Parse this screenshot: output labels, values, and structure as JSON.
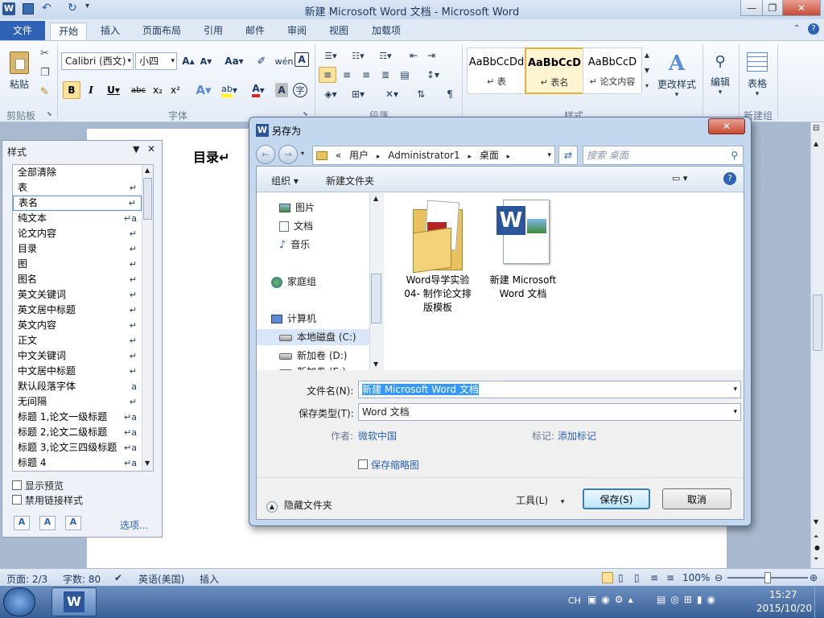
{
  "window": {
    "title": "新建 Microsoft Word 文档 - Microsoft Word"
  },
  "tabs": [
    "文件",
    "开始",
    "插入",
    "页面布局",
    "引用",
    "邮件",
    "审阅",
    "视图",
    "加载项"
  ],
  "ribbon": {
    "clipboard": {
      "paste": "粘贴",
      "group": "剪贴板"
    },
    "font": {
      "name": "Calibri (西文)",
      "size": "小四",
      "bold": "B",
      "italic": "I",
      "underline": "U",
      "strike": "abc",
      "sub": "x₂",
      "sup": "x²",
      "grow": "A",
      "shrink": "A",
      "case": "Aa",
      "group": "字体"
    },
    "paragraph": {
      "group": "段落"
    },
    "styles": {
      "items": [
        {
          "preview": "AaBbCcDd",
          "name": "↵ 表"
        },
        {
          "preview": "AaBbCcD",
          "name": "↵ 表名"
        },
        {
          "preview": "AaBbCcD",
          "name": "↵ 论文内容"
        }
      ],
      "change": "更改样式",
      "group": "样式"
    },
    "edit": {
      "label": "编辑"
    },
    "table": {
      "label": "表格",
      "group": "新建组"
    }
  },
  "document": {
    "heading": "目录↵"
  },
  "style_pane": {
    "title": "样式",
    "items": [
      {
        "label": "全部清除",
        "mark": ""
      },
      {
        "label": "表",
        "mark": "↵"
      },
      {
        "label": "表名",
        "mark": "↵"
      },
      {
        "label": "纯文本",
        "mark": "↵a"
      },
      {
        "label": "论文内容",
        "mark": "↵"
      },
      {
        "label": "目录",
        "mark": "↵"
      },
      {
        "label": "图",
        "mark": "↵"
      },
      {
        "label": "图名",
        "mark": "↵"
      },
      {
        "label": "英文关键词",
        "mark": "↵"
      },
      {
        "label": "英文居中标题",
        "mark": "↵"
      },
      {
        "label": "英文内容",
        "mark": "↵"
      },
      {
        "label": "正文",
        "mark": "↵"
      },
      {
        "label": "中文关键词",
        "mark": "↵"
      },
      {
        "label": "中文居中标题",
        "mark": "↵"
      },
      {
        "label": "默认段落字体",
        "mark": "a"
      },
      {
        "label": "无间隔",
        "mark": "↵"
      },
      {
        "label": "标题 1,论文一级标题",
        "mark": "↵a"
      },
      {
        "label": "标题 2,论文二级标题",
        "mark": "↵a"
      },
      {
        "label": "标题 3,论文三四级标题",
        "mark": "↵a"
      },
      {
        "label": "标题 4",
        "mark": "↵a"
      }
    ],
    "show_preview": "显示预览",
    "disable_linked": "禁用链接样式",
    "options": "选项..."
  },
  "dialog": {
    "title": "另存为",
    "breadcrumb": [
      "«",
      "用户",
      "Administrator1",
      "桌面"
    ],
    "search_placeholder": "搜索 桌面",
    "organize": "组织 ▾",
    "new_folder": "新建文件夹",
    "nav": [
      {
        "label": "图片",
        "icon": "pictures-icon"
      },
      {
        "label": "文档",
        "icon": "documents-icon"
      },
      {
        "label": "音乐",
        "icon": "music-icon"
      },
      {
        "label": "家庭组",
        "icon": "homegroup-icon"
      },
      {
        "label": "计算机",
        "icon": "computer-icon"
      },
      {
        "label": "本地磁盘 (C:)",
        "icon": "drive-icon"
      },
      {
        "label": "新加卷 (D:)",
        "icon": "drive-icon"
      },
      {
        "label": "新加卷 (E:)",
        "icon": "drive-icon"
      }
    ],
    "files": [
      {
        "name": "Word导学实验04- 制作论文排版模板",
        "type": "folder"
      },
      {
        "name": "新建 Microsoft Word 文档",
        "type": "word"
      }
    ],
    "filename_label": "文件名(N):",
    "filename_value": "新建 Microsoft Word 文档",
    "filetype_label": "保存类型(T):",
    "filetype_value": "Word 文档",
    "author_label": "作者:",
    "author_value": "微软中国",
    "tags_label": "标记:",
    "tags_value": "添加标记",
    "thumbnail": "保存缩略图",
    "hide_folders": "隐藏文件夹",
    "tools": "工具(L)",
    "save": "保存(S)",
    "cancel": "取消"
  },
  "status": {
    "page": "页面: 2/3",
    "words": "字数: 80",
    "lang": "英语(美国)",
    "mode": "插入",
    "zoom": "100%"
  },
  "taskbar": {
    "ime": "CH",
    "time": "15:27",
    "date": "2015/10/20"
  }
}
